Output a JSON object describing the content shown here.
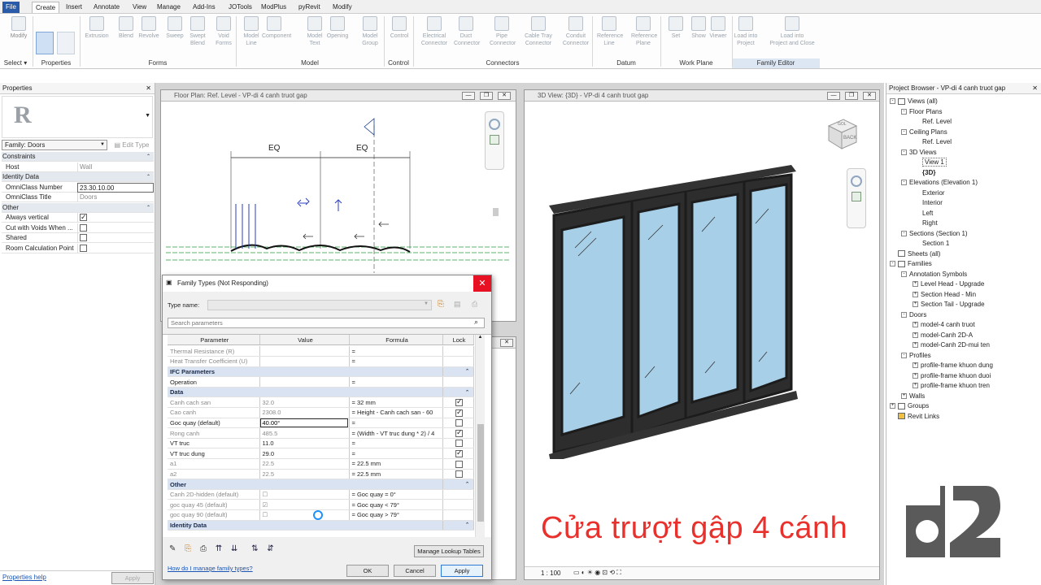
{
  "menubar": {
    "tabs": [
      "File",
      "Create",
      "Insert",
      "Annotate",
      "View",
      "Manage",
      "Add-Ins",
      "JOTools",
      "ModPlus",
      "pyRevit",
      "Modify"
    ],
    "active": "Create"
  },
  "ribbon": {
    "buttons": [
      {
        "label": "Modify"
      },
      {
        "label": "Extrusion"
      },
      {
        "label": "Blend"
      },
      {
        "label": "Revolve"
      },
      {
        "label": "Sweep"
      },
      {
        "label": "Swept\nBlend"
      },
      {
        "label": "Void\nForms"
      },
      {
        "label": "Model\nLine"
      },
      {
        "label": "Component"
      },
      {
        "label": "Model\nText"
      },
      {
        "label": "Opening"
      },
      {
        "label": "Model\nGroup"
      },
      {
        "label": "Control"
      },
      {
        "label": "Electrical\nConnector"
      },
      {
        "label": "Duct\nConnector"
      },
      {
        "label": "Pipe\nConnector"
      },
      {
        "label": "Cable Tray\nConnector"
      },
      {
        "label": "Conduit\nConnector"
      },
      {
        "label": "Reference\nLine"
      },
      {
        "label": "Reference\nPlane"
      },
      {
        "label": "Set"
      },
      {
        "label": "Show"
      },
      {
        "label": "Viewer"
      },
      {
        "label": "Load into\nProject"
      },
      {
        "label": "Load into\nProject and Close"
      }
    ],
    "groups": [
      "Select",
      "Properties",
      "Forms",
      "Model",
      "Control",
      "Connectors",
      "Datum",
      "Work Plane",
      "Family Editor"
    ]
  },
  "properties": {
    "title": "Properties",
    "logo": "R",
    "family_select": "Family: Doors",
    "edit_type": "Edit Type",
    "rows": [
      {
        "kind": "section",
        "label": "Constraints"
      },
      {
        "kind": "prop",
        "label": "Host",
        "value": "Wall"
      },
      {
        "kind": "section",
        "label": "Identity Data"
      },
      {
        "kind": "prop",
        "label": "OmniClass Number",
        "value": "23.30.10.00"
      },
      {
        "kind": "prop",
        "label": "OmniClass Title",
        "value": "Doors"
      },
      {
        "kind": "section",
        "label": "Other"
      },
      {
        "kind": "check",
        "label": "Always vertical",
        "checked": true
      },
      {
        "kind": "check",
        "label": "Cut with Voids When ...",
        "checked": false
      },
      {
        "kind": "check",
        "label": "Shared",
        "checked": false
      },
      {
        "kind": "check",
        "label": "Room Calculation Point",
        "checked": false
      }
    ],
    "help_link": "Properties help",
    "apply": "Apply"
  },
  "floorplan": {
    "title": "Floor Plan: Ref. Level - VP-di 4 canh truot gap",
    "dim1": "EQ",
    "dim2": "EQ"
  },
  "view3d": {
    "title": "3D View: {3D} - VP-di 4 canh truot gap",
    "scale": "1 : 100",
    "cube_top": "GOL",
    "cube_face": "BACK",
    "caption": "Cửa trượt gập 4 cánh",
    "caption_color": "#e8312c"
  },
  "dialog": {
    "title": "Family Types (Not Responding)",
    "type_name_label": "Type name:",
    "search_placeholder": "Search parameters",
    "columns": [
      "Parameter",
      "Value",
      "Formula",
      "Lock"
    ],
    "rows": [
      {
        "kind": "param",
        "name": "Thermal Resistance (R)",
        "value": "",
        "formula": "=",
        "lock": null,
        "grey": true
      },
      {
        "kind": "param",
        "name": "Heat Transfer Coefficient (U)",
        "value": "",
        "formula": "=",
        "lock": null,
        "grey": true
      },
      {
        "kind": "section",
        "name": "IFC Parameters"
      },
      {
        "kind": "param",
        "name": "Operation",
        "value": "",
        "formula": "=",
        "lock": null,
        "grey": false
      },
      {
        "kind": "section",
        "name": "Data"
      },
      {
        "kind": "param",
        "name": "Canh cach san",
        "value": "32.0",
        "formula": "= 32 mm",
        "lock": true,
        "grey": true
      },
      {
        "kind": "param",
        "name": "Cao canh",
        "value": "2308.0",
        "formula": "= Height - Canh cach san - 60",
        "lock": true,
        "grey": true
      },
      {
        "kind": "param",
        "name": "Goc quay (default)",
        "value": "40.00°",
        "formula": "=",
        "lock": false,
        "grey": false,
        "editing": true
      },
      {
        "kind": "param",
        "name": "Rong canh",
        "value": "485.5",
        "formula": "= (Width - VT truc dung * 2) / 4",
        "lock": true,
        "grey": true
      },
      {
        "kind": "param",
        "name": "VT truc",
        "value": "11.0",
        "formula": "=",
        "lock": false,
        "grey": false
      },
      {
        "kind": "param",
        "name": "VT truc dung",
        "value": "29.0",
        "formula": "=",
        "lock": true,
        "grey": false
      },
      {
        "kind": "param",
        "name": "a1",
        "value": "22.5",
        "formula": "= 22.5 mm",
        "lock": false,
        "grey": true
      },
      {
        "kind": "param",
        "name": "a2",
        "value": "22.5",
        "formula": "= 22.5 mm",
        "lock": false,
        "grey": true
      },
      {
        "kind": "section",
        "name": "Other"
      },
      {
        "kind": "param",
        "name": "Canh 2D-hidden (default)",
        "value": "☐",
        "formula": "= Goc quay = 0°",
        "lock": null,
        "grey": true
      },
      {
        "kind": "param",
        "name": "goc quay 45 (default)",
        "value": "☑",
        "formula": "= Goc quay < 79°",
        "lock": null,
        "grey": true
      },
      {
        "kind": "param",
        "name": "goc quay 90 (default)",
        "value": "☐",
        "formula": "= Goc quay > 79°",
        "lock": null,
        "grey": true
      },
      {
        "kind": "section",
        "name": "Identity Data"
      }
    ],
    "manage_lookup": "Manage Lookup Tables",
    "help_link": "How do I manage family types?",
    "ok": "OK",
    "cancel": "Cancel",
    "apply": "Apply"
  },
  "browser": {
    "title": "Project Browser - VP-di 4 canh truot gap",
    "items": [
      {
        "d": 0,
        "exp": "-",
        "text": "Views (all)",
        "icon": "views"
      },
      {
        "d": 1,
        "exp": "-",
        "text": "Floor Plans"
      },
      {
        "d": 2,
        "exp": "",
        "text": "Ref. Level"
      },
      {
        "d": 1,
        "exp": "-",
        "text": "Ceiling Plans"
      },
      {
        "d": 2,
        "exp": "",
        "text": "Ref. Level"
      },
      {
        "d": 1,
        "exp": "-",
        "text": "3D Views"
      },
      {
        "d": 2,
        "exp": "",
        "text": "View 1",
        "sel": true
      },
      {
        "d": 2,
        "exp": "",
        "text": "{3D}",
        "bold": true
      },
      {
        "d": 1,
        "exp": "-",
        "text": "Elevations (Elevation 1)"
      },
      {
        "d": 2,
        "exp": "",
        "text": "Exterior"
      },
      {
        "d": 2,
        "exp": "",
        "text": "Interior"
      },
      {
        "d": 2,
        "exp": "",
        "text": "Left"
      },
      {
        "d": 2,
        "exp": "",
        "text": "Right"
      },
      {
        "d": 1,
        "exp": "-",
        "text": "Sections (Section 1)"
      },
      {
        "d": 2,
        "exp": "",
        "text": "Section 1"
      },
      {
        "d": 0,
        "exp": "",
        "text": "Sheets (all)",
        "icon": "sheet"
      },
      {
        "d": 0,
        "exp": "-",
        "text": "Families",
        "icon": "fam"
      },
      {
        "d": 1,
        "exp": "-",
        "text": "Annotation Symbols"
      },
      {
        "d": 2,
        "exp": "+",
        "text": "Level Head - Upgrade"
      },
      {
        "d": 2,
        "exp": "+",
        "text": "Section Head - Min"
      },
      {
        "d": 2,
        "exp": "+",
        "text": "Section Tail - Upgrade"
      },
      {
        "d": 1,
        "exp": "-",
        "text": "Doors"
      },
      {
        "d": 2,
        "exp": "+",
        "text": "model-4 canh truot"
      },
      {
        "d": 2,
        "exp": "+",
        "text": "model-Canh 2D-A"
      },
      {
        "d": 2,
        "exp": "+",
        "text": "model-Canh 2D-mui ten"
      },
      {
        "d": 1,
        "exp": "-",
        "text": "Profiles"
      },
      {
        "d": 2,
        "exp": "+",
        "text": "profile-frame khuon dung"
      },
      {
        "d": 2,
        "exp": "+",
        "text": "profile-frame khuon duoi"
      },
      {
        "d": 2,
        "exp": "+",
        "text": "profile-frame khuon tren"
      },
      {
        "d": 1,
        "exp": "+",
        "text": "Walls"
      },
      {
        "d": 0,
        "exp": "+",
        "text": "Groups",
        "icon": "grp"
      },
      {
        "d": 0,
        "exp": "",
        "text": "Revit Links",
        "icon": "link"
      }
    ]
  }
}
